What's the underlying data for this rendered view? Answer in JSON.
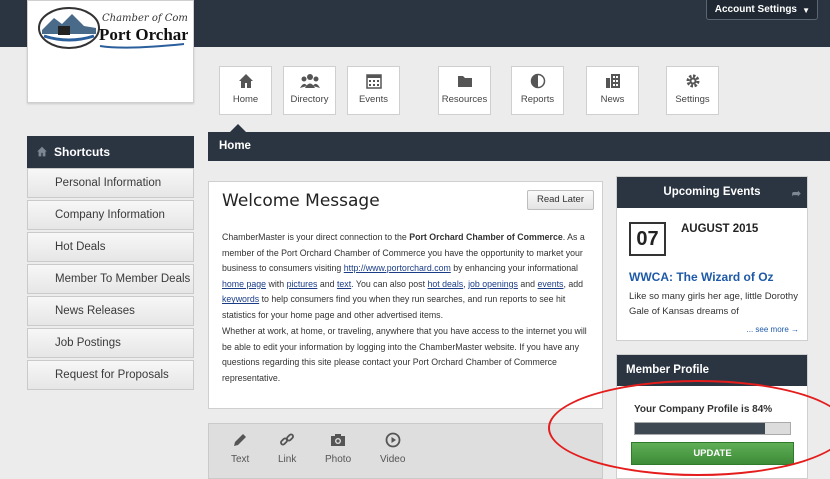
{
  "header": {
    "account_settings": "Account Settings"
  },
  "logo": {
    "line1": "Chamber of Commerce",
    "line2": "Port Orchard"
  },
  "nav": {
    "items": [
      {
        "label": "Home",
        "icon": "home-icon"
      },
      {
        "label": "Directory",
        "icon": "people-icon"
      },
      {
        "label": "Events",
        "icon": "calendar-icon"
      },
      {
        "label": "Resources",
        "icon": "folder-icon"
      },
      {
        "label": "Reports",
        "icon": "pie-chart-icon"
      },
      {
        "label": "News",
        "icon": "news-icon"
      },
      {
        "label": "Settings",
        "icon": "gear-icon"
      }
    ]
  },
  "sidebar": {
    "title": "Shortcuts",
    "items": [
      "Personal Information",
      "Company Information",
      "Hot Deals",
      "Member To Member Deals",
      "News Releases",
      "Job Postings",
      "Request for Proposals"
    ]
  },
  "main": {
    "bar_title": "Home",
    "welcome": {
      "title": "Welcome Message",
      "read_later": "Read Later"
    }
  },
  "post_bar": {
    "items": [
      {
        "label": "Text",
        "icon": "pencil-icon"
      },
      {
        "label": "Link",
        "icon": "link-icon"
      },
      {
        "label": "Photo",
        "icon": "camera-icon"
      },
      {
        "label": "Video",
        "icon": "play-icon"
      }
    ]
  },
  "events": {
    "title": "Upcoming Events",
    "day": "07",
    "month": "AUGUST 2015",
    "event_title": "WWCA: The Wizard of Oz",
    "description": "Like so many girls her age, little Dorothy Gale of Kansas dreams of",
    "see_more": "... see more →"
  },
  "profile": {
    "title": "Member Profile",
    "status": "Your Company Profile is 84%",
    "progress_percent": 84,
    "update_label": "UPDATE"
  },
  "colors": {
    "dark_bar": "#2b3542",
    "link": "#1b3d87",
    "accent_green": "#3d8b37",
    "annotation_red": "#e41c1c"
  }
}
